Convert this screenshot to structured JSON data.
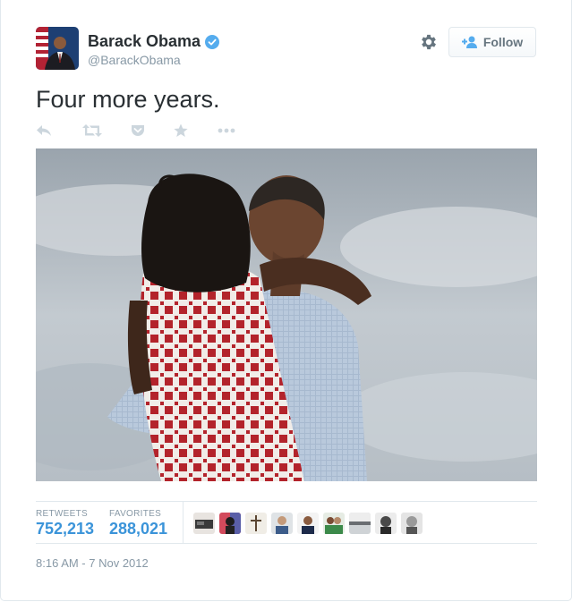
{
  "author": {
    "name": "Barack Obama",
    "handle": "@BarackObama",
    "verified": true
  },
  "header": {
    "follow_label": "Follow",
    "settings_icon": "gear-icon",
    "follow_icon": "add-user-icon"
  },
  "tweet": {
    "text": "Four more years.",
    "timestamp": "8:16 AM - 7 Nov 2012"
  },
  "actions": [
    {
      "name": "reply",
      "icon": "reply-icon"
    },
    {
      "name": "retweet",
      "icon": "retweet-icon"
    },
    {
      "name": "pocket",
      "icon": "pocket-icon"
    },
    {
      "name": "favorite",
      "icon": "star-icon"
    },
    {
      "name": "more",
      "icon": "ellipsis-icon"
    }
  ],
  "stats": {
    "retweets_label": "RETWEETS",
    "retweets_value": "752,213",
    "favorites_label": "FAVORITES",
    "favorites_value": "288,021"
  },
  "favoriters_count": 9,
  "colors": {
    "link_blue": "#3b94d9",
    "verified_blue": "#55acee",
    "muted_gray": "#8899a6",
    "text_dark": "#292f33"
  }
}
